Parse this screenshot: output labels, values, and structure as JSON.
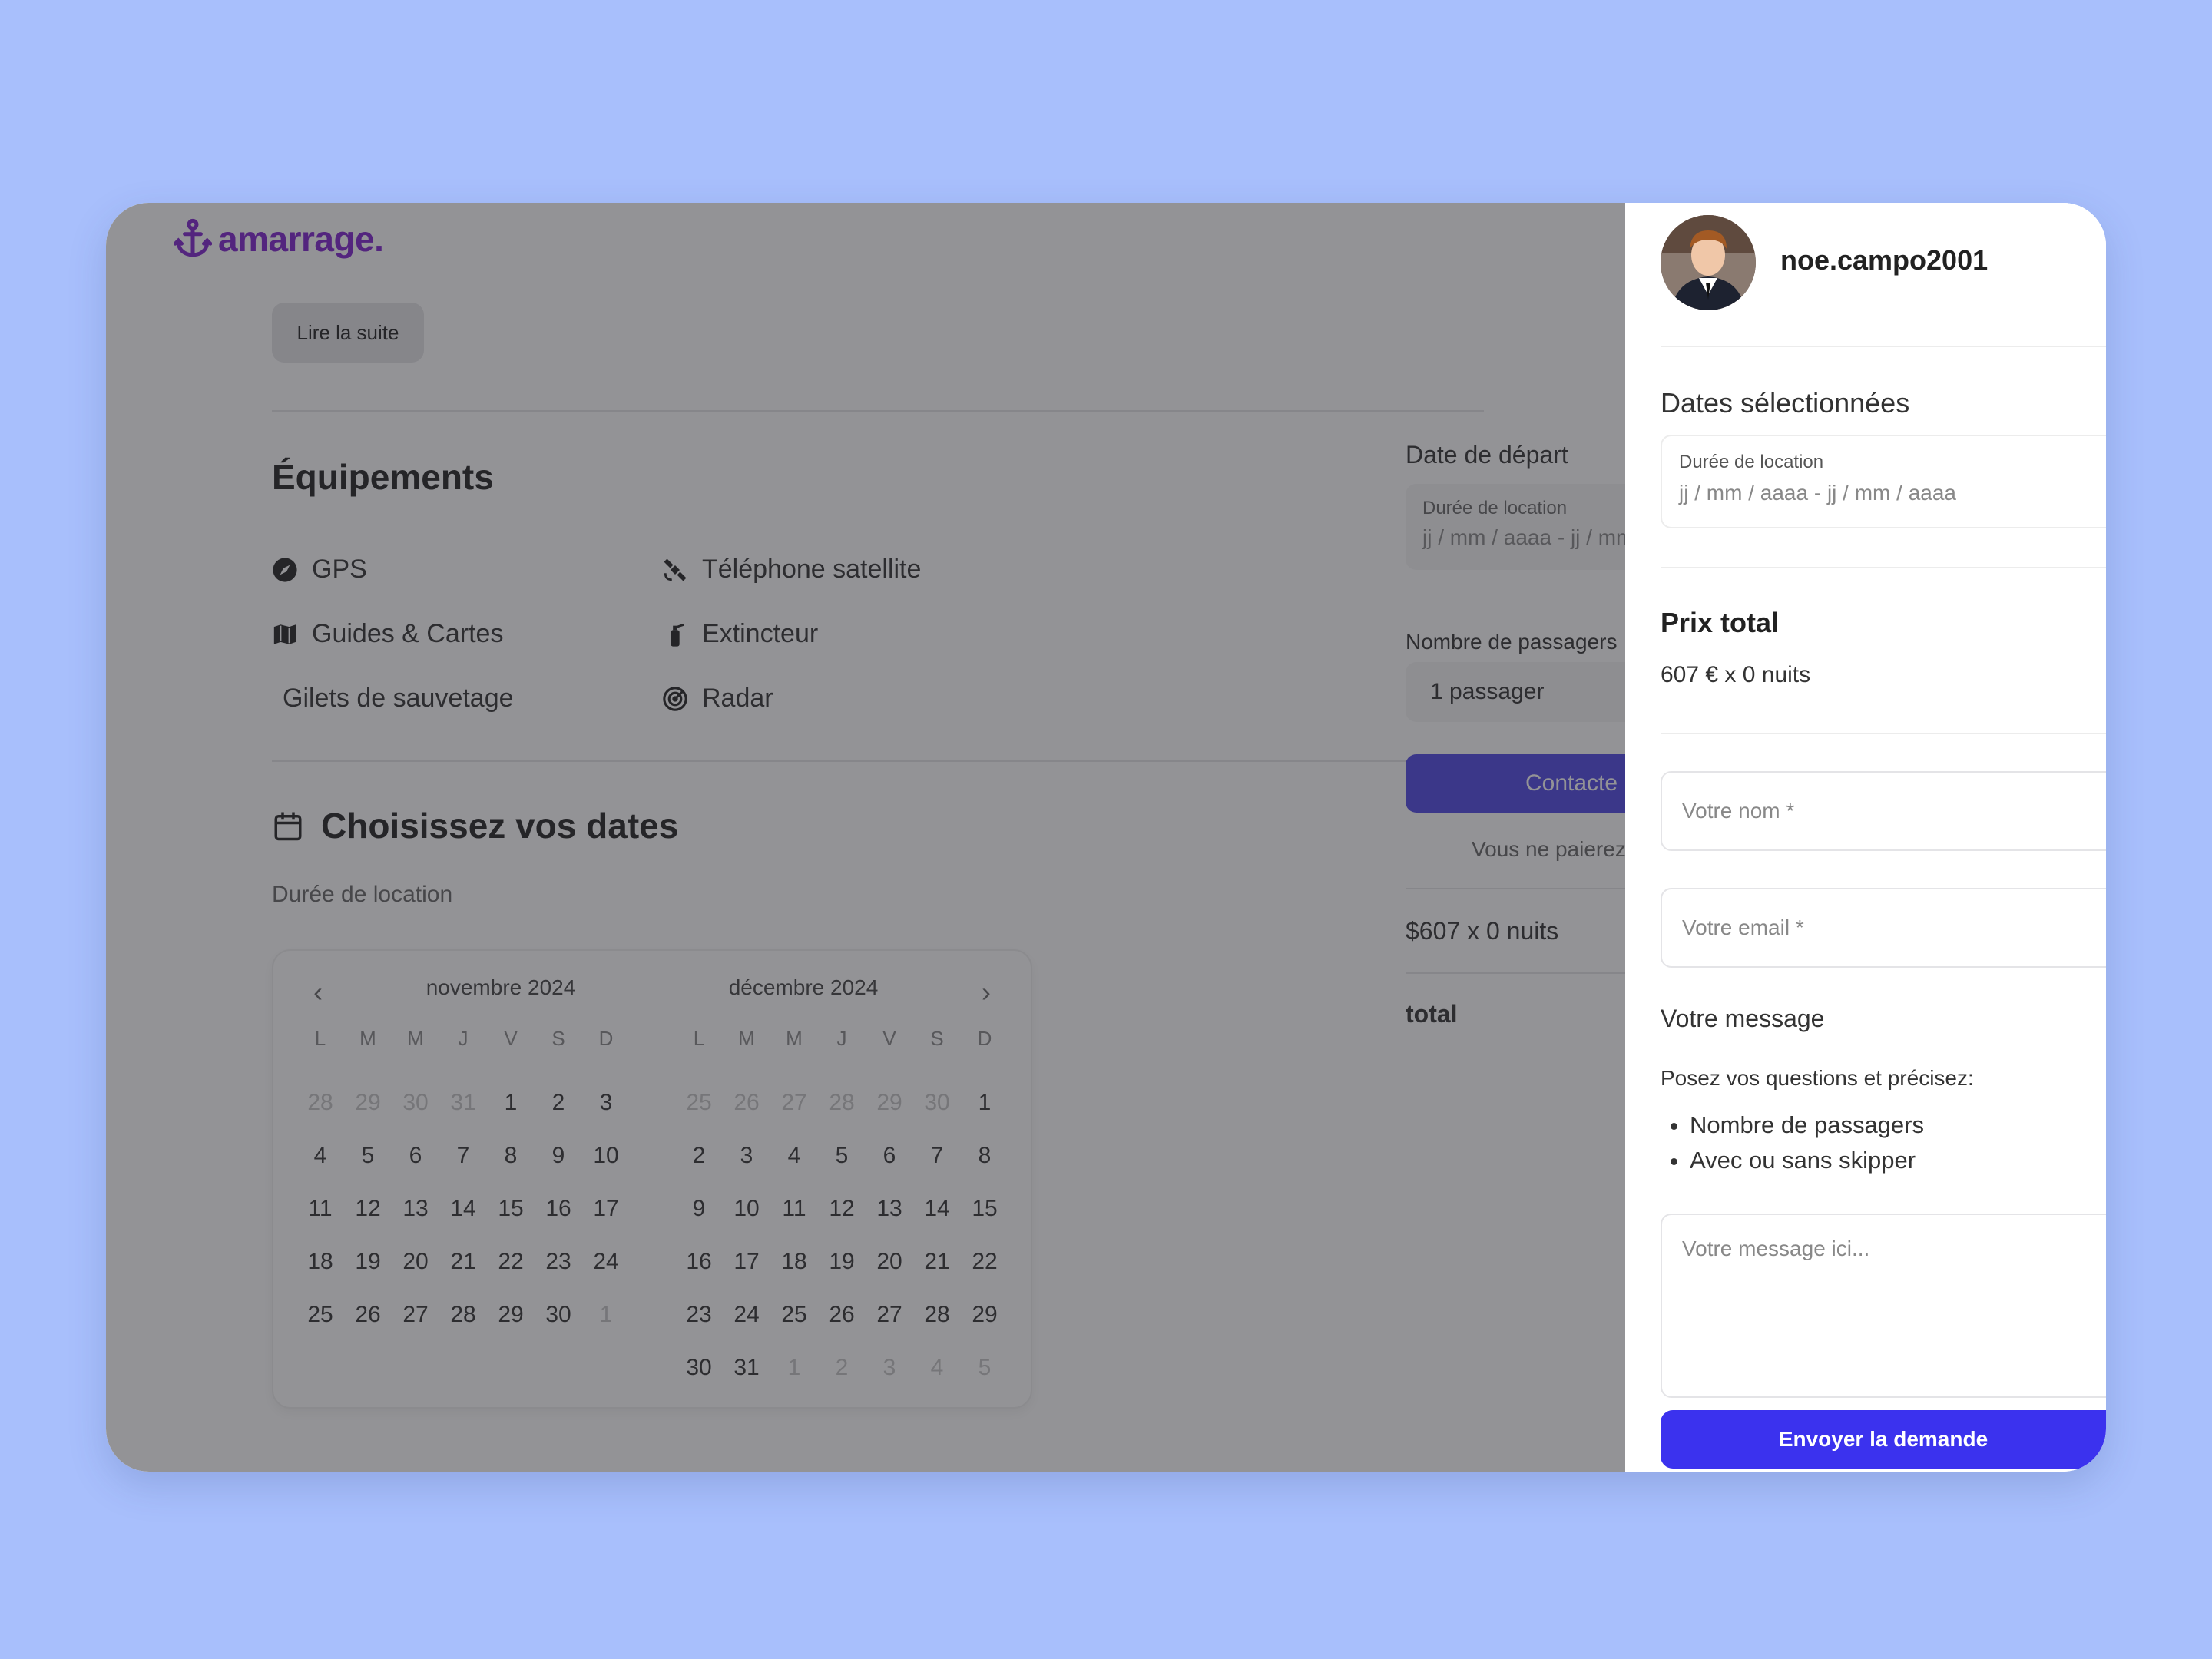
{
  "app": {
    "logo_text": "amarrage."
  },
  "listing": {
    "read_more": "Lire la suite",
    "equipment_title": "Équipements",
    "amenities": [
      {
        "label": "GPS",
        "icon": "compass-icon"
      },
      {
        "label": "Téléphone satellite",
        "icon": "satellite-icon"
      },
      {
        "label": "Guides & Cartes",
        "icon": "map-icon"
      },
      {
        "label": "Extincteur",
        "icon": "fire-extinguisher-icon"
      },
      {
        "label": "Gilets de sauvetage",
        "icon": ""
      },
      {
        "label": "Radar",
        "icon": "radar-icon"
      }
    ],
    "dates_title": "Choisissez vos dates",
    "duration_label": "Durée de location"
  },
  "calendar": {
    "weekdays": [
      "L",
      "M",
      "M",
      "J",
      "V",
      "S",
      "D"
    ],
    "months": [
      {
        "title": "novembre 2024",
        "days": [
          [
            "28",
            "29",
            "30",
            "31",
            "1",
            "2",
            "3"
          ],
          [
            "4",
            "5",
            "6",
            "7",
            "8",
            "9",
            "10"
          ],
          [
            "11",
            "12",
            "13",
            "14",
            "15",
            "16",
            "17"
          ],
          [
            "18",
            "19",
            "20",
            "21",
            "22",
            "23",
            "24"
          ],
          [
            "25",
            "26",
            "27",
            "28",
            "29",
            "30",
            "1"
          ]
        ],
        "muted": [
          [
            0,
            0
          ],
          [
            0,
            1
          ],
          [
            0,
            2
          ],
          [
            0,
            3
          ],
          [
            4,
            6
          ]
        ]
      },
      {
        "title": "décembre 2024",
        "days": [
          [
            "25",
            "26",
            "27",
            "28",
            "29",
            "30",
            "1"
          ],
          [
            "2",
            "3",
            "4",
            "5",
            "6",
            "7",
            "8"
          ],
          [
            "9",
            "10",
            "11",
            "12",
            "13",
            "14",
            "15"
          ],
          [
            "16",
            "17",
            "18",
            "19",
            "20",
            "21",
            "22"
          ],
          [
            "23",
            "24",
            "25",
            "26",
            "27",
            "28",
            "29"
          ],
          [
            "30",
            "31",
            "1",
            "2",
            "3",
            "4",
            "5"
          ]
        ],
        "muted": [
          [
            0,
            0
          ],
          [
            0,
            1
          ],
          [
            0,
            2
          ],
          [
            0,
            3
          ],
          [
            0,
            4
          ],
          [
            0,
            5
          ],
          [
            5,
            2
          ],
          [
            5,
            3
          ],
          [
            5,
            4
          ],
          [
            5,
            5
          ],
          [
            5,
            6
          ]
        ]
      }
    ]
  },
  "booking": {
    "departure_title": "Date de départ",
    "duration_label": "Durée de location",
    "duration_placeholder": "jj / mm / aaaa  - jj / mm",
    "passengers_label": "Nombre de passagers",
    "passengers_value": "1 passager",
    "contact_button": "Contacte",
    "payment_note": "Vous ne paierez",
    "price_line": "$607 x 0 nuits",
    "total_label": "total"
  },
  "drawer": {
    "username": "noe.campo2001",
    "selected_dates_title": "Dates sélectionnées",
    "duration_label": "Durée de location",
    "duration_placeholder": "jj / mm / aaaa  - jj / mm / aaaa",
    "total_price_title": "Prix total",
    "total_price_value": "607 € x 0 nuits",
    "name_placeholder": "Votre nom *",
    "email_placeholder": "Votre email *",
    "message_title": "Votre message",
    "message_hint": "Posez vos questions et précisez:",
    "message_points": [
      "Nombre de passagers",
      "Avec ou sans skipper"
    ],
    "message_placeholder": "Votre message ici...",
    "send_button": "Envoyer la demande"
  },
  "colors": {
    "brand": "#7e22ce",
    "primary": "#3b32ee",
    "background": "#a8bffc"
  }
}
